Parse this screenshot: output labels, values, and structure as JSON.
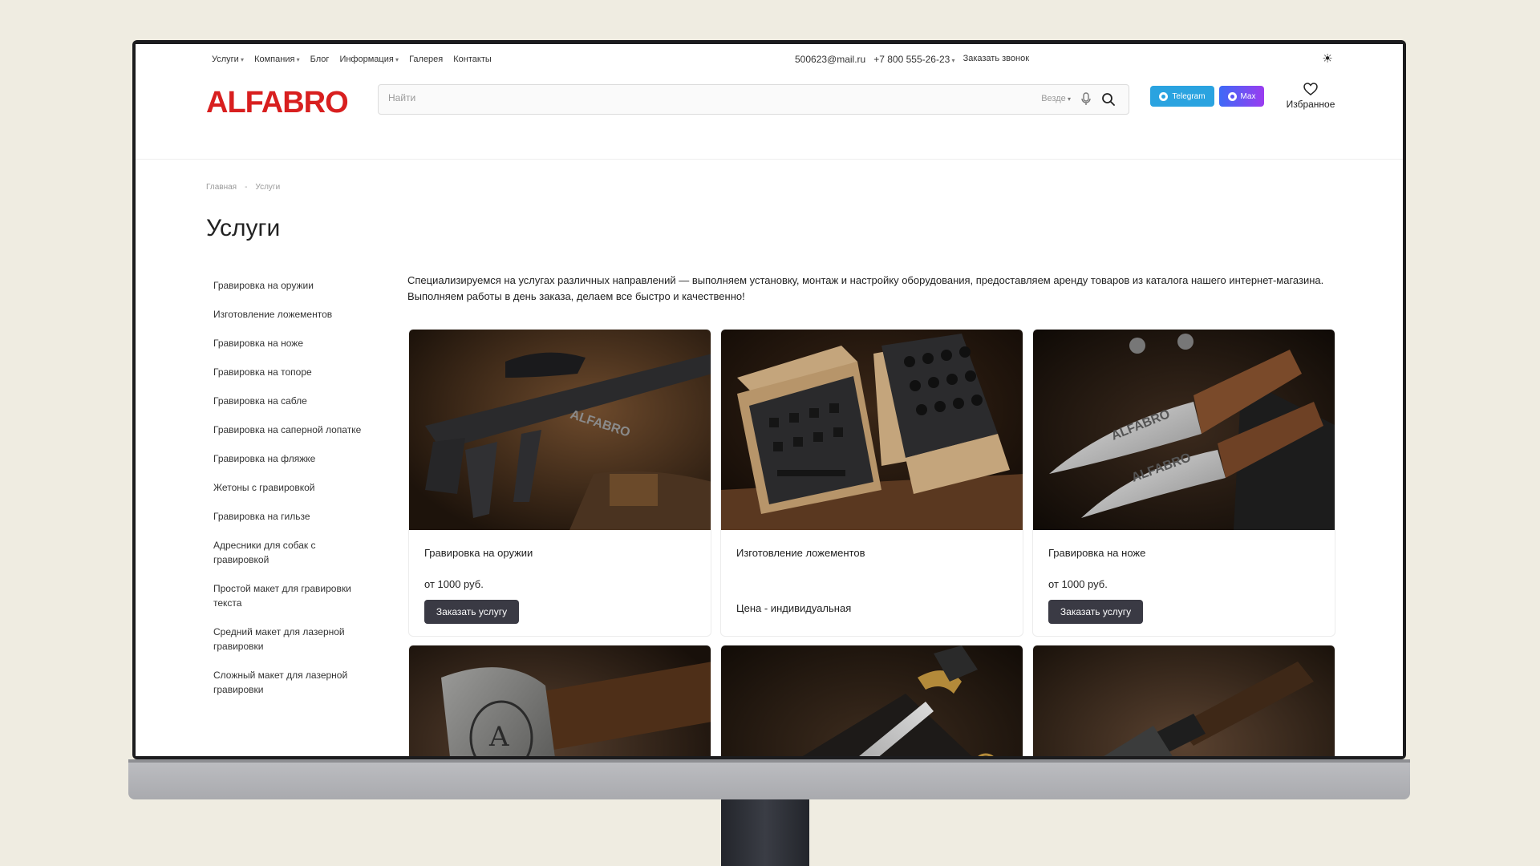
{
  "topnav": [
    {
      "label": "Услуги",
      "dropdown": true
    },
    {
      "label": "Компания",
      "dropdown": true
    },
    {
      "label": "Блог",
      "dropdown": false
    },
    {
      "label": "Информация",
      "dropdown": true
    },
    {
      "label": "Галерея",
      "dropdown": false
    },
    {
      "label": "Контакты",
      "dropdown": false
    }
  ],
  "contacts": {
    "email": "500623@mail.ru",
    "phone": "+7 800 555-26-23",
    "call_label": "Заказать звонок"
  },
  "logo": "ALFABRO",
  "search": {
    "placeholder": "Найти",
    "scope": "Везде"
  },
  "messengers": {
    "telegram": "Telegram",
    "max": "Max"
  },
  "favorites_label": "Избранное",
  "breadcrumb": [
    "Главная",
    "Услуги"
  ],
  "page_title": "Услуги",
  "sidebar": [
    "Гравировка на оружии",
    "Изготовление ложементов",
    "Гравировка на ноже",
    "Гравировка на топоре",
    "Гравировка на сабле",
    "Гравировка на саперной лопатке",
    "Гравировка на фляжке",
    "Жетоны с гравировкой",
    "Гравировка на гильзе",
    "Адресники для собак с гравировкой",
    "Простой макет для гравировки текста",
    "Средний макет для лазерной гравировки",
    "Сложный макет для лазерной гравировки"
  ],
  "intro": "Специализируемся на услугах различных направлений — выполняем установку, монтаж и настройку оборудования, предоставляем аренду товаров из каталога нашего интернет-магазина. Выполняем работы в день заказа, делаем все быстро и качественно!",
  "cards": [
    {
      "name": "Гравировка на оружии",
      "price": "от 1000 руб.",
      "button": "Заказать услугу",
      "image": "engraved-rifle"
    },
    {
      "name": "Изготовление ложементов",
      "price": "Цена - индивидуальная",
      "button": "",
      "image": "foam-case"
    },
    {
      "name": "Гравировка на ноже",
      "price": "от 1000 руб.",
      "button": "Заказать услугу",
      "image": "engraved-knives"
    },
    {
      "name": "",
      "price": "",
      "button": "",
      "image": "engraved-axe"
    },
    {
      "name": "",
      "price": "",
      "button": "",
      "image": "engraved-sabre"
    },
    {
      "name": "",
      "price": "",
      "button": "",
      "image": "engraved-shovel"
    }
  ],
  "colors": {
    "brand": "#d81f1f",
    "telegram": "#2aa3e0",
    "button_dark": "#3a3a44",
    "page_background": "#efece1"
  }
}
